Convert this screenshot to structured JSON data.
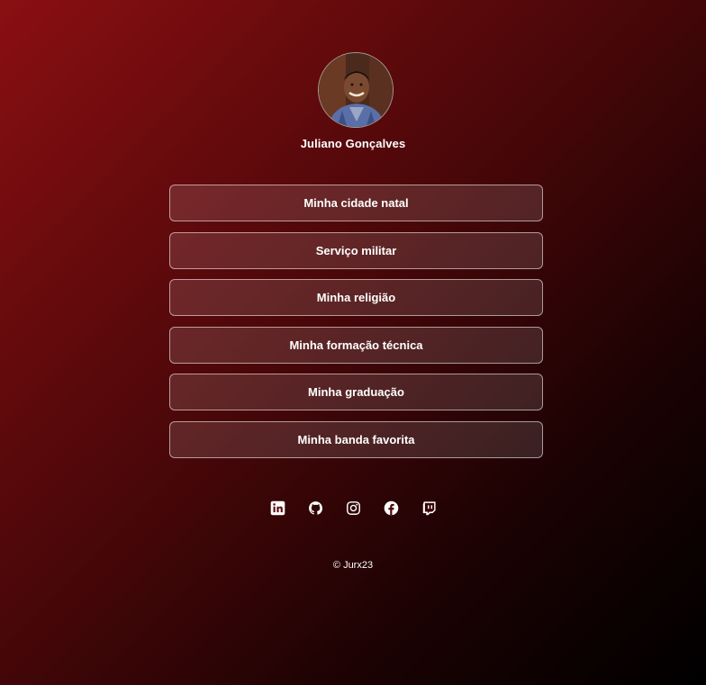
{
  "profile": {
    "name": "Juliano Gonçalves",
    "avatar_icon": "profile-photo"
  },
  "links": [
    {
      "label": "Minha cidade natal"
    },
    {
      "label": "Serviço militar"
    },
    {
      "label": "Minha religião"
    },
    {
      "label": "Minha formação técnica"
    },
    {
      "label": "Minha graduação"
    },
    {
      "label": "Minha banda favorita"
    }
  ],
  "socials": [
    {
      "icon": "linkedin-icon"
    },
    {
      "icon": "github-icon"
    },
    {
      "icon": "instagram-icon"
    },
    {
      "icon": "facebook-icon"
    },
    {
      "icon": "twitch-icon"
    }
  ],
  "footer": {
    "text": "© Jurx23"
  },
  "colors": {
    "background_start": "#8a0f12",
    "background_end": "#000000",
    "text": "#ffffff"
  }
}
